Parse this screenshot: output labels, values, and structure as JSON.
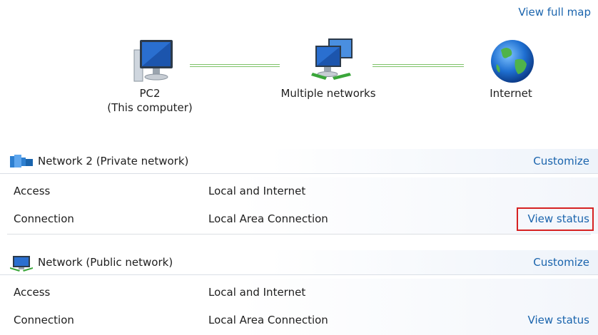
{
  "map": {
    "view_full_map": "View full map",
    "nodes": [
      {
        "line1": "PC2",
        "line2": "(This computer)",
        "icon": "computer-icon"
      },
      {
        "line1": "Multiple networks",
        "line2": "",
        "icon": "multiple-networks-icon"
      },
      {
        "line1": "Internet",
        "line2": "",
        "icon": "globe-icon"
      }
    ],
    "link_color": "#7fc26a"
  },
  "networks": [
    {
      "name": "Network  2 (Private network)",
      "icon": "private-network-icon",
      "customize": "Customize",
      "access_label": "Access",
      "access_value": "Local and Internet",
      "connection_label": "Connection",
      "connection_value": "Local Area Connection",
      "view_status": "View status"
    },
    {
      "name": "Network (Public network)",
      "icon": "public-network-icon",
      "customize": "Customize",
      "access_label": "Access",
      "access_value": "Local and Internet",
      "connection_label": "Connection",
      "connection_value": "Local Area Connection",
      "view_status": "View status"
    }
  ],
  "colors": {
    "link": "#1a64ad",
    "highlight": "#d62222"
  }
}
